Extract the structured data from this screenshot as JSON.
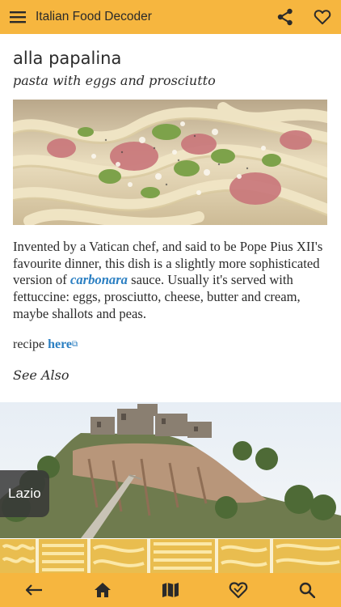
{
  "app": {
    "title": "Italian Food Decoder"
  },
  "dish": {
    "name": "alla papalina",
    "subtitle": "pasta with eggs and prosciutto",
    "description_before": "Invented by a Vatican chef, and said to be Pope Pius XII's favourite dinner, this dish is a slightly more sophisticated version of ",
    "description_link": "carbonara",
    "description_after": " sauce. Usually it's served with fettuccine: eggs, prosciutto, cheese, butter and cream, maybe shallots and peas.",
    "recipe_prefix": "recipe ",
    "recipe_link": "here",
    "external_link_icon": "⧉"
  },
  "see_also": {
    "heading": "See Also",
    "region_label": "Lazio"
  },
  "icons": {
    "menu": "menu-icon",
    "share": "share-icon",
    "favorite": "heart-icon",
    "back": "back-arrow-icon",
    "home": "home-icon",
    "map": "map-icon",
    "favorites": "heart-icon",
    "search": "search-icon"
  },
  "colors": {
    "bar": "#F6B63F",
    "link": "#2b7fc2",
    "label_bg": "#373737"
  }
}
